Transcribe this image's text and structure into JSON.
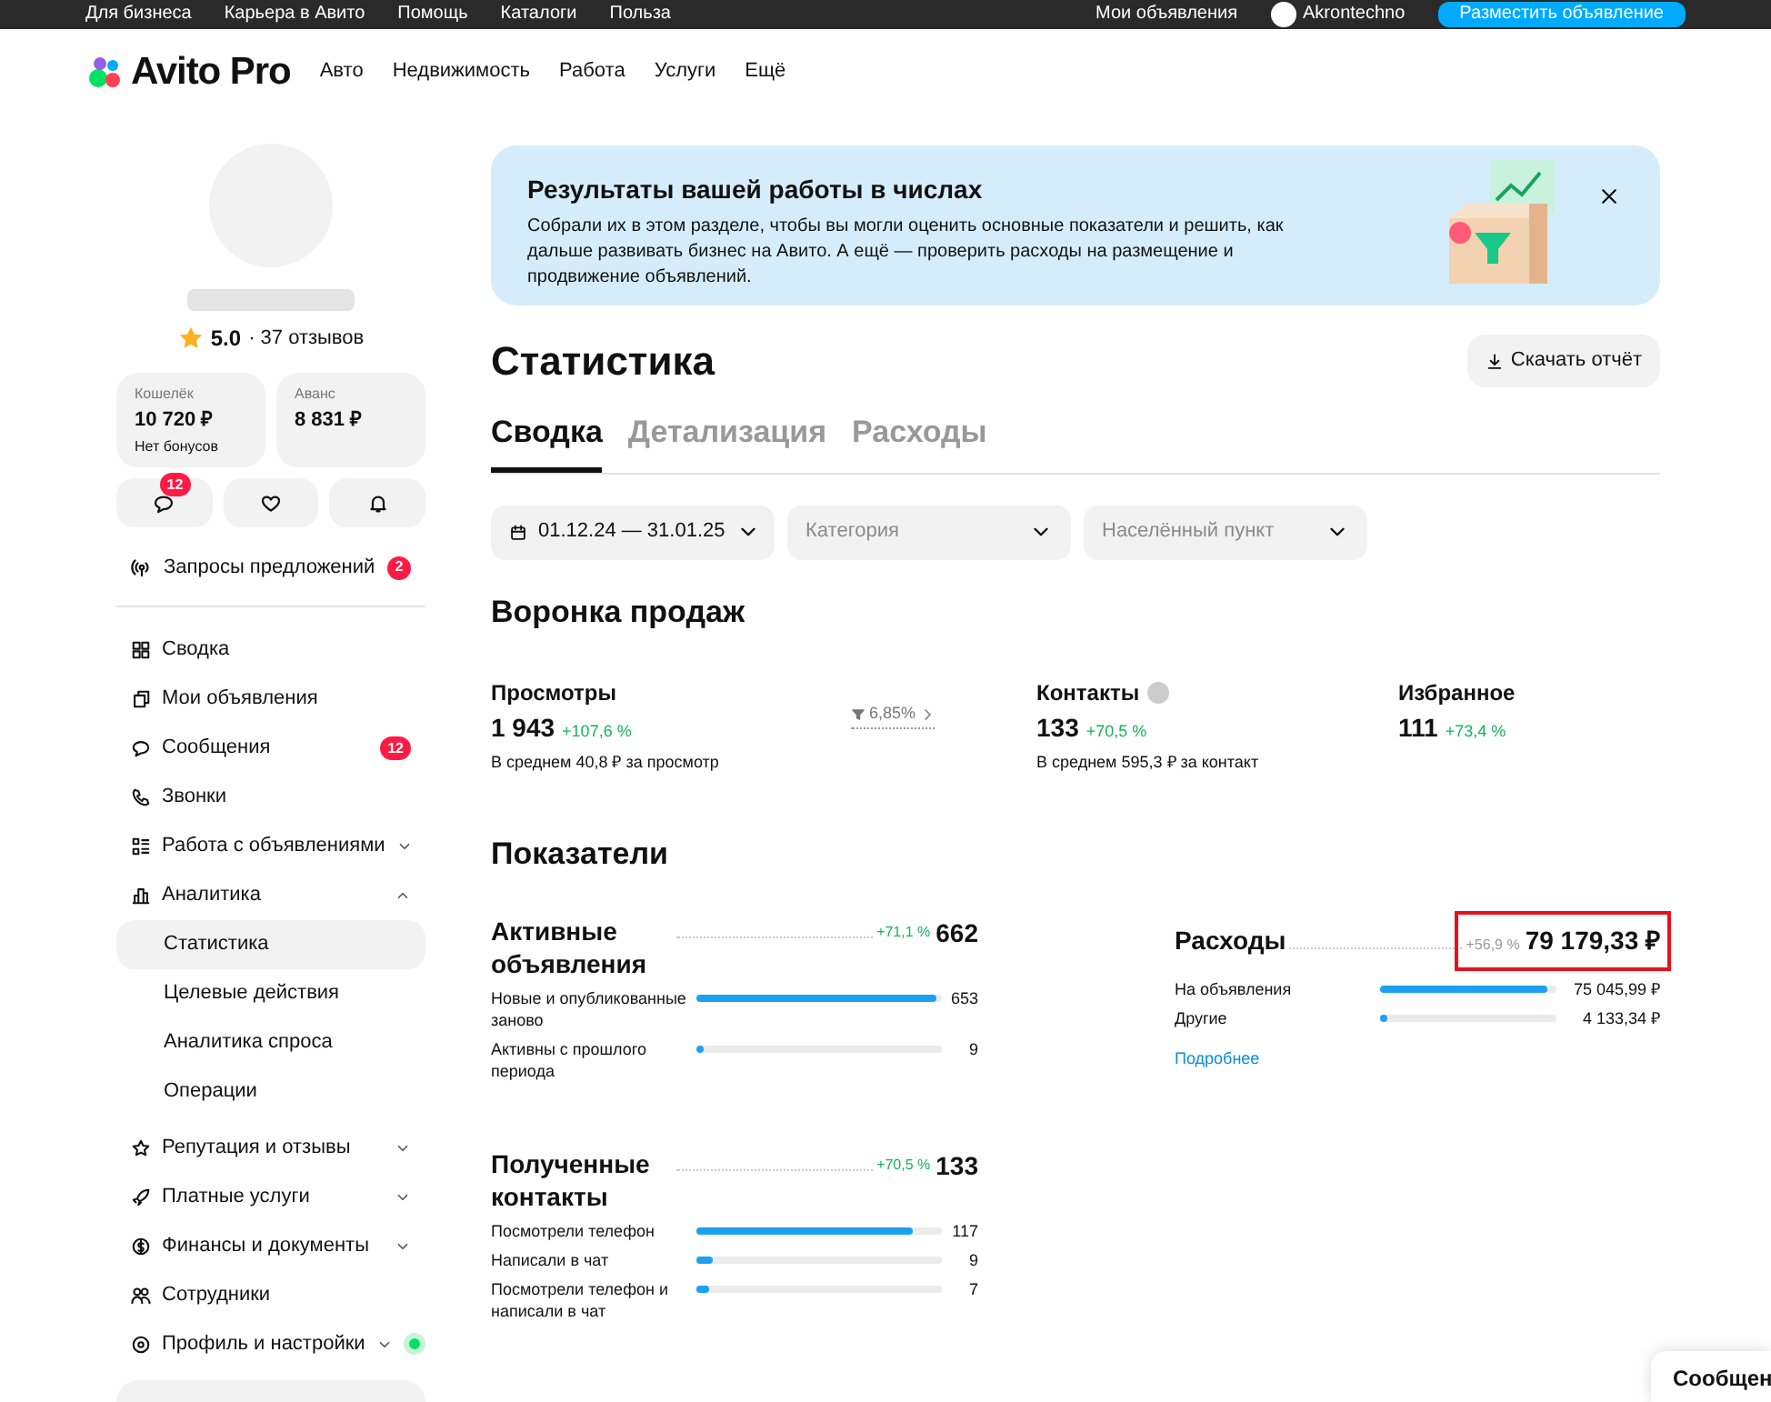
{
  "top_bar": {
    "links": [
      "Для бизнеса",
      "Карьера в Авито",
      "Помощь",
      "Каталоги",
      "Польза"
    ],
    "account_link": "Мои объявления",
    "user": "Akrontechno",
    "post_button": "Разместить объявление"
  },
  "header": {
    "logo": "Avito Pro",
    "nav": [
      "Авто",
      "Недвижимость",
      "Работа",
      "Услуги",
      "Ещё"
    ]
  },
  "profile": {
    "rating": "5.0",
    "reviews": "· 37 отзывов",
    "wallet": {
      "label": "Кошелёк",
      "amount": "10 720 ₽",
      "note": "Нет бонусов"
    },
    "advance": {
      "label": "Аванс",
      "amount": "8 831 ₽"
    },
    "quick_buttons": [
      {
        "kind": "chat",
        "badge": "12"
      },
      {
        "kind": "heart"
      },
      {
        "kind": "bell"
      }
    ]
  },
  "sidebar": {
    "requests": {
      "label": "Запросы предложений",
      "badge": "2"
    },
    "items": [
      {
        "label": "Сводка"
      },
      {
        "label": "Мои объявления"
      },
      {
        "label": "Сообщения",
        "badge": "12"
      },
      {
        "label": "Звонки"
      },
      {
        "label": "Работа с объявлениями",
        "expanded": false
      },
      {
        "label": "Аналитика",
        "expanded": true,
        "children": [
          {
            "label": "Статистика",
            "selected": true
          },
          {
            "label": "Целевые действия",
            "selected": false
          },
          {
            "label": "Аналитика спроса",
            "selected": false
          },
          {
            "label": "Операции",
            "selected": false
          }
        ]
      },
      {
        "label": "Репутация и отзывы",
        "expanded": false
      },
      {
        "label": "Платные услуги",
        "expanded": false
      },
      {
        "label": "Финансы и документы",
        "expanded": false
      },
      {
        "label": "Сотрудники"
      },
      {
        "label": "Профиль и настройки",
        "expanded": false,
        "status_dot": true
      }
    ]
  },
  "banner": {
    "title": "Результаты вашей работы в числах",
    "text": "Собрали их в этом разделе, чтобы вы могли оценить основные показатели и решить, как дальше развивать бизнес на Авито. А ещё — проверить расходы на размещение и продвижение объявлений."
  },
  "page_title": "Статистика",
  "download_button": "Скачать отчёт",
  "tabs": [
    {
      "label": "Сводка",
      "selected": true
    },
    {
      "label": "Детализация",
      "selected": false
    },
    {
      "label": "Расходы",
      "selected": false
    }
  ],
  "filters": [
    {
      "kind": "date",
      "value": "01.12.24 — 31.01.25"
    },
    {
      "kind": "select",
      "placeholder": "Категория"
    },
    {
      "kind": "select",
      "placeholder": "Населённый пункт"
    }
  ],
  "funnel": {
    "title": "Воронка продаж",
    "conversion": "6,85%",
    "metrics": [
      {
        "label": "Просмотры",
        "value": "1 943",
        "change": "+107,6 %",
        "note": "В среднем 40,8 ₽ за просмотр"
      },
      {
        "label": "Контакты",
        "value": "133",
        "change": "+70,5 %",
        "note": "В среднем 595,3 ₽ за контакт",
        "help": true
      },
      {
        "label": "Избранное",
        "value": "111",
        "change": "+73,4 %"
      }
    ]
  },
  "indicators": {
    "title": "Показатели",
    "groups": [
      {
        "title": "Активные объявления",
        "change": "+71,1 %",
        "total": "662",
        "rows": [
          {
            "label": "Новые и опубликованные заново",
            "value": "653",
            "level": 0.98
          },
          {
            "label": "Активны с прошлого периода",
            "value": "9",
            "level": 0.02
          }
        ]
      },
      {
        "title": "Полученные контакты",
        "change": "+70,5 %",
        "total": "133",
        "rows": [
          {
            "label": "Посмотрели телефон",
            "value": "117",
            "level": 0.88
          },
          {
            "label": "Написали в чат",
            "value": "9",
            "level": 0.07
          },
          {
            "label": "Посмотрели телефон и написали в чат",
            "value": "7",
            "level": 0.05
          }
        ]
      }
    ],
    "expenses": {
      "title": "Расходы",
      "change": "+56,9 %",
      "total": "79 179,33 ₽",
      "highlighted": true,
      "rows": [
        {
          "label": "На объявления",
          "value": "75 045,99 ₽",
          "level": 0.95
        },
        {
          "label": "Другие",
          "value": "4 133,34 ₽",
          "level": 0.04
        }
      ],
      "link": "Подробнее"
    }
  },
  "chat_widget": "Сообщен"
}
